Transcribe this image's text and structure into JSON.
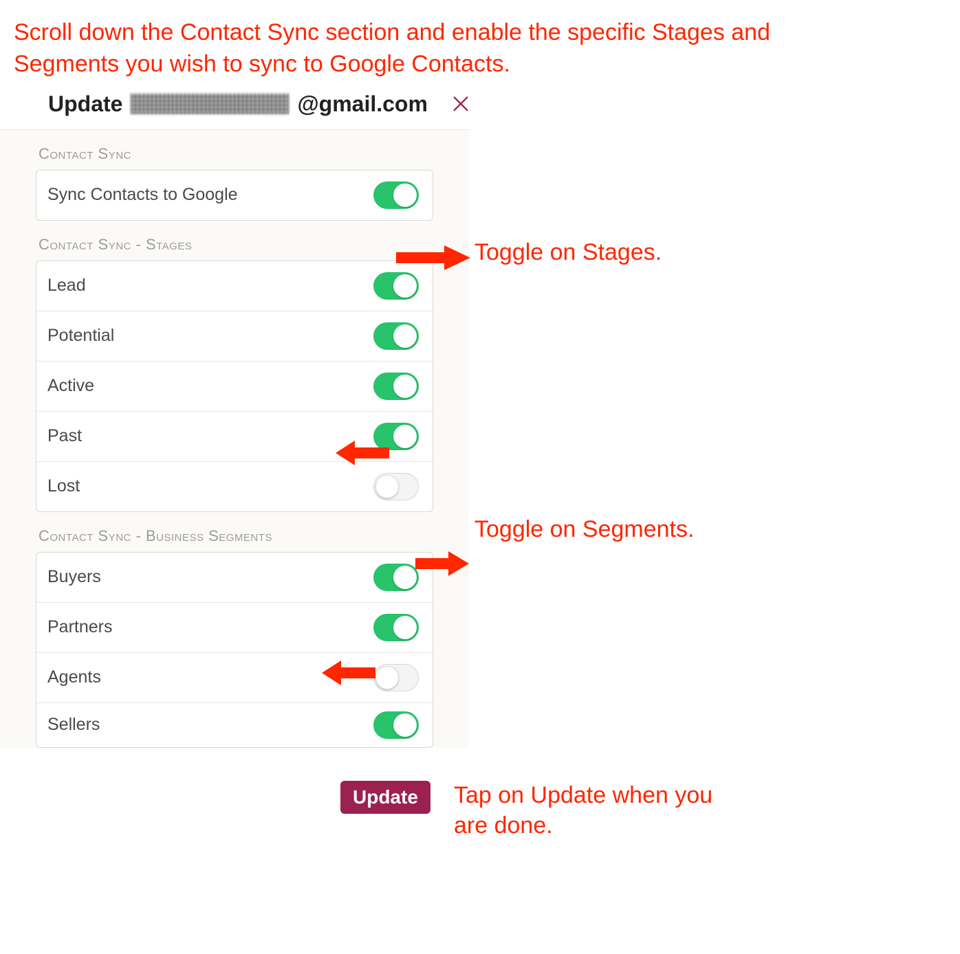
{
  "instruction": "Scroll down the Contact Sync section and enable the specific Stages and Segments you wish to sync to Google Contacts.",
  "header": {
    "title_prefix": "Update",
    "email_suffix": "@gmail.com"
  },
  "sections": {
    "contact_sync": {
      "header": "Contact Sync",
      "row": {
        "label": "Sync Contacts to Google",
        "on": true
      }
    },
    "stages": {
      "header": "Contact Sync - Stages",
      "rows": [
        {
          "label": "Lead",
          "on": true
        },
        {
          "label": "Potential",
          "on": true
        },
        {
          "label": "Active",
          "on": true
        },
        {
          "label": "Past",
          "on": true
        },
        {
          "label": "Lost",
          "on": false
        }
      ]
    },
    "segments": {
      "header": "Contact Sync - Business Segments",
      "rows": [
        {
          "label": "Buyers",
          "on": true
        },
        {
          "label": "Partners",
          "on": true
        },
        {
          "label": "Agents",
          "on": false
        },
        {
          "label": "Sellers",
          "on": true
        }
      ]
    }
  },
  "update_button": "Update",
  "annotations": {
    "stages": "Toggle on Stages.",
    "segments": "Toggle on Segments.",
    "update": "Tap on Update when you are done."
  },
  "colors": {
    "accent_red": "#ff2600",
    "toggle_on": "#28c36b",
    "button": "#9a2150"
  }
}
